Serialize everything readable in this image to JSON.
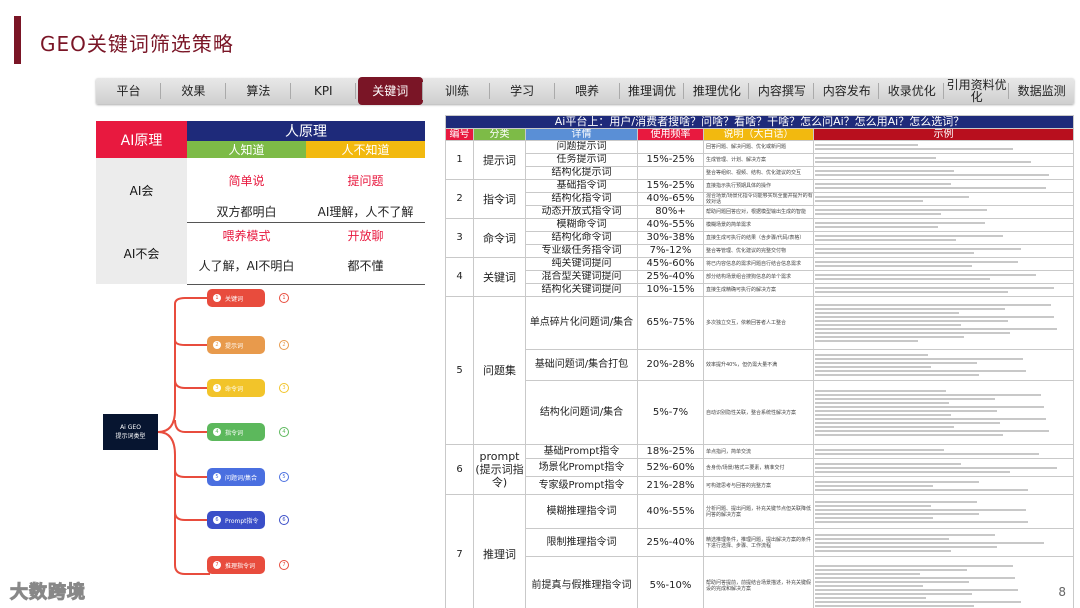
{
  "header": {
    "title": "GEO关键词筛选策略"
  },
  "tabs": [
    "平台",
    "效果",
    "算法",
    "KPI",
    "关键词",
    "训练",
    "学习",
    "喂养",
    "推理调优",
    "推理优化",
    "内容撰写",
    "内容发布",
    "收录优化",
    "引用资料优化",
    "数据监测"
  ],
  "active_tab": "关键词",
  "principle": {
    "ai_principle": "AI原理",
    "human_principle": "人原理",
    "human_knows": "人知道",
    "human_not_know": "人不知道",
    "ai_knows": "AI会",
    "ai_not_know": "AI不会",
    "simple_say": "简单说",
    "ask_question": "提问题",
    "both_understand": "双方都明白",
    "ai_understands": "AI理解，人不了解",
    "feed_mode": "喂养模式",
    "open_chat": "开放聊",
    "human_understands": "人了解，AI不明白",
    "neither": "都不懂"
  },
  "mindmap": {
    "root": "Ai GEO\n提示词类型",
    "nodes": [
      {
        "label": "关键词",
        "num": "1",
        "color": "#e84c3d"
      },
      {
        "label": "提示词",
        "num": "2",
        "color": "#e89a4c"
      },
      {
        "label": "命令词",
        "num": "3",
        "color": "#f2c42a"
      },
      {
        "label": "指令词",
        "num": "4",
        "color": "#5cb85c"
      },
      {
        "label": "问题词/集合",
        "num": "5",
        "color": "#4a6fe0"
      },
      {
        "label": "Prompt指令",
        "num": "6",
        "color": "#3a4ec8"
      },
      {
        "label": "推理指令词",
        "num": "7",
        "color": "#e84c3d"
      }
    ]
  },
  "table": {
    "caption": "Ai平台上：用户/消费者搜啥？问啥？看啥？干啥？怎么问Ai？怎么用Ai？怎么选词？",
    "headers": [
      "编号",
      "分类",
      "详情",
      "使用频率",
      "说明（大白话）",
      "示例"
    ],
    "groups": [
      {
        "no": "1",
        "cat": "提示词",
        "rows": [
          {
            "d": "问题提示词",
            "f": "",
            "e": "回答问题、解决问题、优化或新问题"
          },
          {
            "d": "任务提示词",
            "f": "15%-25%",
            "e": "生成管理、计划、解决方案"
          },
          {
            "d": "结构化提示词",
            "f": "",
            "e": "整合等组织、视频、结构、优化建议的交互"
          }
        ]
      },
      {
        "no": "2",
        "cat": "指令词",
        "rows": [
          {
            "d": "基础指令词",
            "f": "15%-25%",
            "e": "直接指示执行预期具体的操作"
          },
          {
            "d": "结构化指令词",
            "f": "40%-65%",
            "e": "混合场景/场景化指令词能够实现全面并提升的有效对话"
          },
          {
            "d": "动态开放式指令词",
            "f": "80%+",
            "e": "帮助问题回答应对，根据模型输出生成的智能"
          }
        ]
      },
      {
        "no": "3",
        "cat": "命令词",
        "rows": [
          {
            "d": "模糊命令词",
            "f": "40%-55%",
            "e": "模糊场景的简单需求"
          },
          {
            "d": "结构化命令词",
            "f": "30%-38%",
            "e": "直接生成可执行的结果（含步骤/代码/表格）"
          },
          {
            "d": "专业级任务指令词",
            "f": "7%-12%",
            "e": "整合等管理、优化建议的完整交付物"
          }
        ]
      },
      {
        "no": "4",
        "cat": "关键词",
        "rows": [
          {
            "d": "纯关键词提问",
            "f": "45%-60%",
            "e": "将已内容信息的需求问题自行结合信息需求"
          },
          {
            "d": "混合型关键词提问",
            "f": "25%-40%",
            "e": "部分结构场景组合搜狗信息的单个需求"
          },
          {
            "d": "结构化关键词提问",
            "f": "10%-15%",
            "e": "直接生成精确可执行的解决方案"
          }
        ]
      },
      {
        "no": "5",
        "cat": "问题集",
        "rows": [
          {
            "d": "单点碎片化问题词/集合",
            "f": "65%-75%",
            "e": "多次独立交互，依赖回答者人工整合"
          },
          {
            "d": "基础问题词/集合打包",
            "f": "20%-28%",
            "e": "效率提升40%，但仍需大量不满"
          },
          {
            "d": "结构化问题词/集合",
            "f": "5%-7%",
            "e": "自动识别隐性关联，整合系统性解决方案"
          }
        ]
      },
      {
        "no": "6",
        "cat": "prompt\n(提示词指令)",
        "rows": [
          {
            "d": "基础Prompt指令",
            "f": "18%-25%",
            "e": "单点指问，简单交流"
          },
          {
            "d": "场景化Prompt指令",
            "f": "52%-60%",
            "e": "含身份/场景/格式三要素，精准交付"
          },
          {
            "d": "专家级Prompt指令",
            "f": "21%-28%",
            "e": "可构建思考与回答的完整方案"
          }
        ]
      },
      {
        "no": "7",
        "cat": "推理词",
        "rows": [
          {
            "d": "模糊推理指令词",
            "f": "40%-55%",
            "e": "分析问题、提出问题，补充关键节点但关联降低问答的解决方案"
          },
          {
            "d": "限制推理指令词",
            "f": "25%-40%",
            "e": "精选推理条件，推理问题，提出解决方案的条件下进行选择、步骤、工作流程"
          },
          {
            "d": "前提真与假推理指令词",
            "f": "5%-10%",
            "e": "帮助问答提前，前提结合场景描述，补充关键假设的完成和解决方案"
          }
        ]
      }
    ]
  },
  "footer": {
    "brand": "大数跨境",
    "page": "8"
  }
}
